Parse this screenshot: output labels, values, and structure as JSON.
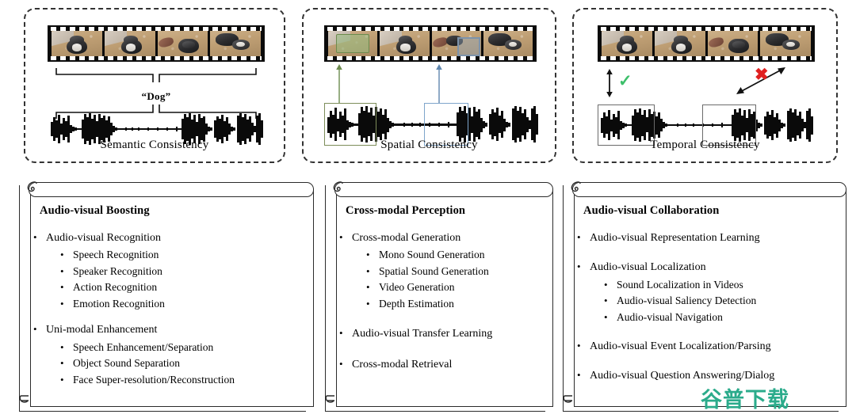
{
  "figure": {
    "consistency_cards": [
      {
        "id": "semantic",
        "caption": "Semantic Consistency",
        "label": "“Dog”",
        "film_frames": 4,
        "annotations": []
      },
      {
        "id": "spatial",
        "caption": "Spatial Consistency",
        "label": "",
        "film_frames": 4,
        "annotations": [
          "green-region-arrow",
          "blue-region-arrow"
        ]
      },
      {
        "id": "temporal",
        "caption": "Temporal Consistency",
        "label": "",
        "film_frames": 4,
        "annotations": [
          "check-mark",
          "cross-mark"
        ]
      }
    ],
    "marks": {
      "check": "✓",
      "cross": "✖"
    },
    "colors": {
      "green_box": "#7d8d5a",
      "blue_box": "#7ea5cb",
      "gray_box": "#6b6b6b",
      "check": "#3cbf6a",
      "cross": "#e02020",
      "watermark": "#2bab8b",
      "film": "#0b0b0b"
    }
  },
  "taxonomy": {
    "bullet": "•",
    "panels": [
      {
        "id": "audio-visual-boosting",
        "title": "Audio-visual Boosting",
        "items": [
          {
            "label": "Audio-visual Recognition",
            "children": [
              "Speech Recognition",
              "Speaker Recognition",
              "Action Recognition",
              "Emotion Recognition"
            ]
          },
          {
            "label": "Uni-modal Enhancement",
            "children": [
              "Speech Enhancement/Separation",
              "Object Sound Separation",
              "Face Super-resolution/Reconstruction"
            ]
          }
        ]
      },
      {
        "id": "cross-modal-perception",
        "title": "Cross-modal Perception",
        "items": [
          {
            "label": "Cross-modal Generation",
            "children": [
              "Mono Sound Generation",
              "Spatial Sound Generation",
              "Video Generation",
              "Depth Estimation"
            ]
          },
          {
            "label": "Audio-visual Transfer Learning",
            "children": []
          },
          {
            "label": "Cross-modal Retrieval",
            "children": []
          }
        ]
      },
      {
        "id": "audio-visual-collaboration",
        "title": "Audio-visual Collaboration",
        "items": [
          {
            "label": "Audio-visual Representation Learning",
            "children": []
          },
          {
            "label": "Audio-visual Localization",
            "children": [
              "Sound Localization in Videos",
              "Audio-visual Saliency Detection",
              "Audio-visual Navigation"
            ]
          },
          {
            "label": "Audio-visual Event Localization/Parsing",
            "children": []
          },
          {
            "label": "Audio-visual Question Answering/Dialog",
            "children": []
          }
        ]
      }
    ]
  },
  "watermark": {
    "text": "谷普下载"
  }
}
